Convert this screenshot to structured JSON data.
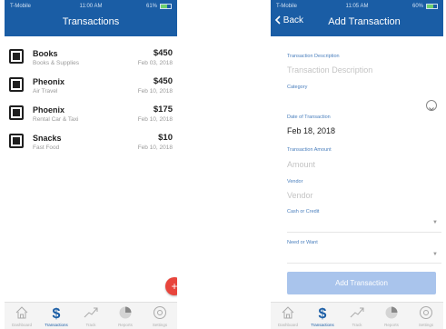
{
  "status_left": {
    "carrier": "T-Mobile",
    "time": "11:00 AM",
    "battery": "61%"
  },
  "status_right": {
    "carrier": "T-Mobile",
    "time": "11:05 AM",
    "battery": "60%"
  },
  "transactions_screen": {
    "title": "Transactions",
    "items": [
      {
        "name": "Books",
        "category": "Books & Supplies",
        "amount": "$450",
        "date": "Feb 03, 2018"
      },
      {
        "name": "Pheonix",
        "category": "Air Travel",
        "amount": "$450",
        "date": "Feb 10, 2018"
      },
      {
        "name": "Phoenix",
        "category": "Rental Car & Taxi",
        "amount": "$175",
        "date": "Feb 10, 2018"
      },
      {
        "name": "Snacks",
        "category": "Fast Food",
        "amount": "$10",
        "date": "Feb 10, 2018"
      }
    ],
    "fab_label": "+"
  },
  "add_screen": {
    "back_label": "Back",
    "title": "Add Transaction",
    "fields": {
      "description_label": "Transaction Description",
      "description_placeholder": "Transaction Description",
      "category_label": "Category",
      "date_label": "Date of Transaction",
      "date_value": "Feb 18, 2018",
      "amount_label": "Transaction Amount",
      "amount_placeholder": "Amount",
      "vendor_label": "Vendor",
      "vendor_placeholder": "Vendor",
      "cash_label": "Cash or Credit",
      "need_label": "Need or Want"
    },
    "submit_label": "Add Transaction"
  },
  "tabbar": {
    "tabs": [
      {
        "label": "Dashboard",
        "icon": "home-icon"
      },
      {
        "label": "Transactions",
        "icon": "dollar-icon"
      },
      {
        "label": "Track",
        "icon": "trend-icon"
      },
      {
        "label": "Reports",
        "icon": "pie-icon"
      },
      {
        "label": "Settings",
        "icon": "gear-icon"
      }
    ],
    "active_index": 1
  },
  "colors": {
    "brand_blue": "#1a5da5",
    "fab_red": "#e8453c",
    "button_disabled": "#a9c4ec"
  }
}
